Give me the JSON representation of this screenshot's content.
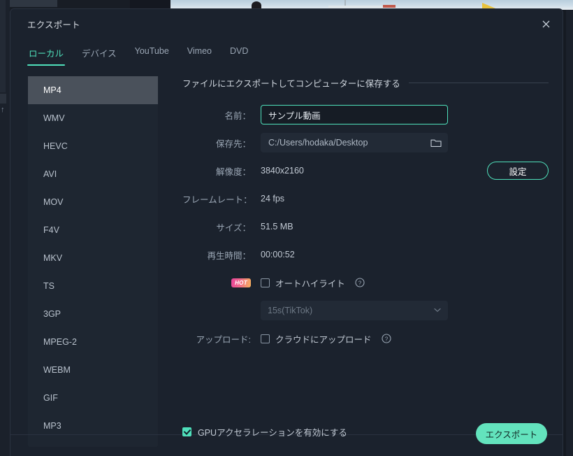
{
  "window": {
    "title": "エクスポート",
    "close_icon": "close-icon"
  },
  "tabs": [
    {
      "label": "ローカル",
      "active": true
    },
    {
      "label": "デバイス",
      "active": false
    },
    {
      "label": "YouTube",
      "active": false
    },
    {
      "label": "Vimeo",
      "active": false
    },
    {
      "label": "DVD",
      "active": false
    }
  ],
  "formats": [
    {
      "label": "MP4",
      "selected": true
    },
    {
      "label": "WMV",
      "selected": false
    },
    {
      "label": "HEVC",
      "selected": false
    },
    {
      "label": "AVI",
      "selected": false
    },
    {
      "label": "MOV",
      "selected": false
    },
    {
      "label": "F4V",
      "selected": false
    },
    {
      "label": "MKV",
      "selected": false
    },
    {
      "label": "TS",
      "selected": false
    },
    {
      "label": "3GP",
      "selected": false
    },
    {
      "label": "MPEG-2",
      "selected": false
    },
    {
      "label": "WEBM",
      "selected": false
    },
    {
      "label": "GIF",
      "selected": false
    },
    {
      "label": "MP3",
      "selected": false
    }
  ],
  "section": {
    "heading": "ファイルにエクスポートしてコンピューターに保存する"
  },
  "fields": {
    "name_label": "名前：",
    "name_value": "サンプル動画",
    "name_placeholder": "サンプル動画",
    "destination_label": "保存先：",
    "destination_value": "C:/Users/hodaka/Desktop",
    "folder_icon": "folder-icon",
    "resolution_label": "解像度：",
    "resolution_value": "3840x2160",
    "settings_button": "設定",
    "framerate_label": "フレームレート：",
    "framerate_value": "24 fps",
    "size_label": "サイズ：",
    "size_value": "51.5 MB",
    "duration_label": "再生時間：",
    "duration_value": "00:00:52"
  },
  "highlight": {
    "badge": "HOT",
    "checkbox_label": "オートハイライト",
    "checked": false,
    "help_icon": "help-icon",
    "duration_selected": "15s(TikTok)",
    "chevron_icon": "chevron-down-icon"
  },
  "upload": {
    "row_label": "アップロード:",
    "checkbox_label": "クラウドにアップロード",
    "checked": false,
    "help_icon": "help-icon"
  },
  "footer": {
    "gpu_label": "GPUアクセラレーションを有効にする",
    "gpu_checked": true,
    "export_button": "エクスポート"
  },
  "colors": {
    "accent": "#4fe0bb",
    "export_button_bg": "#63e3bd",
    "dialog_bg": "#1b222d",
    "panel_bg": "#1e2631",
    "selected_item_bg": "#4a515b",
    "hot_badge_from": "#e8449b",
    "hot_badge_to": "#f5b25c"
  }
}
